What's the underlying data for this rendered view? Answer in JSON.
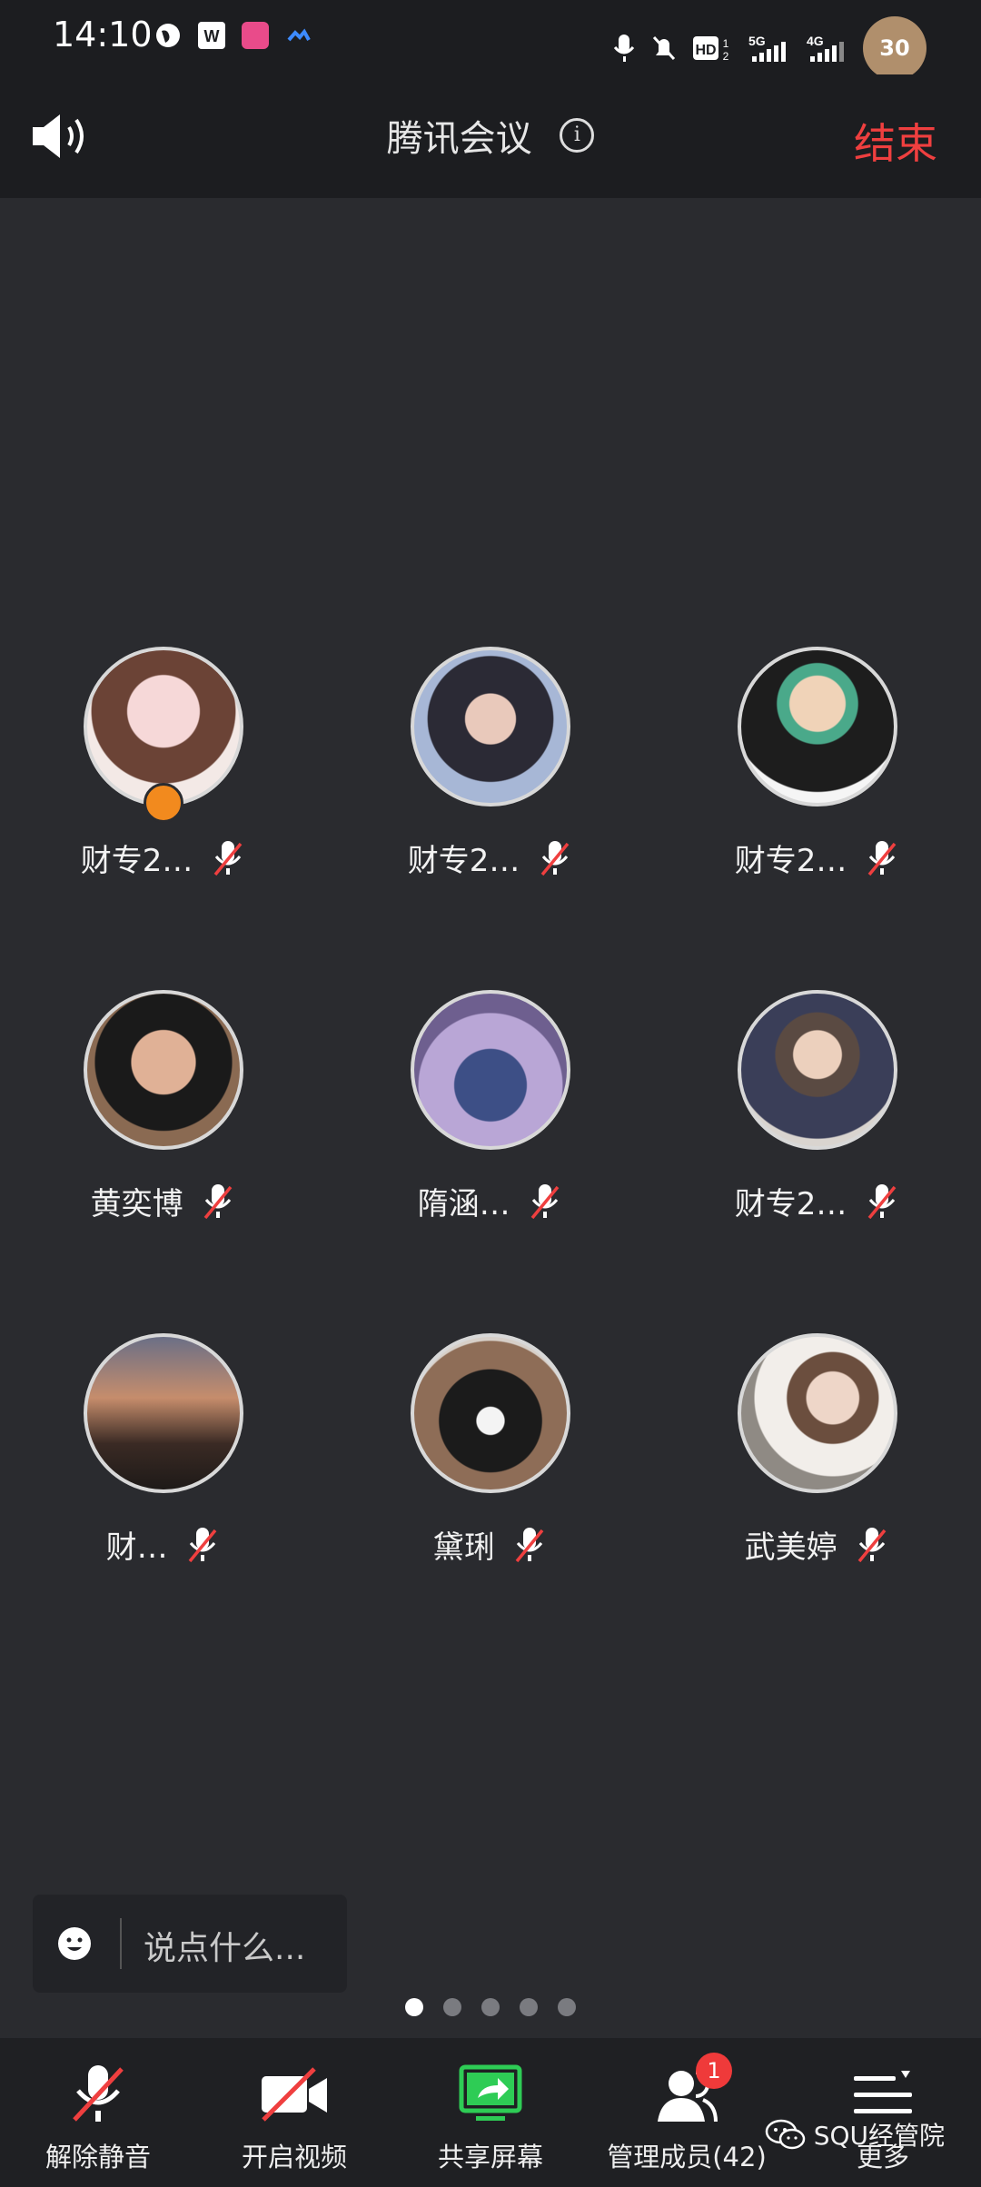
{
  "status_bar": {
    "time": "14:10",
    "battery": "30",
    "icons_left": [
      "globe-icon",
      "wps-icon",
      "lalu-app-icon",
      "meeting-app-icon"
    ],
    "icons_right": [
      "mic-indicator-icon",
      "mute-bell-icon",
      "hd-icon",
      "5g-signal-icon",
      "4g-signal-icon"
    ]
  },
  "header": {
    "title": "腾讯会议",
    "end_label": "结束"
  },
  "participants": [
    {
      "name": "财专2…",
      "mic": "muted",
      "host": true
    },
    {
      "name": "财专2…",
      "mic": "muted",
      "host": false
    },
    {
      "name": "财专2…",
      "mic": "muted",
      "host": false
    },
    {
      "name": "黄奕博",
      "mic": "muted",
      "host": false
    },
    {
      "name": "隋涵…",
      "mic": "muted",
      "host": false
    },
    {
      "name": "财专2…",
      "mic": "muted",
      "host": false
    },
    {
      "name": "财…",
      "mic": "muted",
      "host": false
    },
    {
      "name": "黛琍",
      "mic": "muted",
      "host": false
    },
    {
      "name": "武美婷",
      "mic": "muted",
      "host": false
    }
  ],
  "chat": {
    "placeholder": "说点什么..."
  },
  "pager": {
    "total": 5,
    "current": 1
  },
  "toolbar": {
    "unmute": "解除静音",
    "video": "开启视频",
    "share": "共享屏幕",
    "members": "管理成员(42)",
    "members_badge": "1",
    "more": "更多"
  },
  "watermark": "SQU经管院",
  "colors": {
    "background": "#2a2b2f",
    "end_red": "#ef3f3f",
    "share_green": "#2ecc55",
    "host_orange": "#f28a1e"
  }
}
